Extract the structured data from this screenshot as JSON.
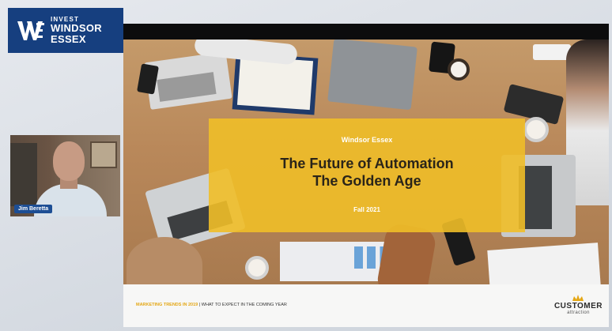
{
  "logo": {
    "line1": "INVEST",
    "line2": "WINDSOR",
    "line3": "ESSEX"
  },
  "presenter": {
    "name": "Jim Beretta"
  },
  "slide": {
    "brand": "Windsor Essex",
    "title_line1": "The Future of Automation",
    "title_line2": "The Golden Age",
    "date": "Fall 2021",
    "footer_highlight": "MARKETING TRENDS IN 2019",
    "footer_rest": "WHAT TO EXPECT IN THE COMING YEAR",
    "footer_logo_main": "CUSTOMER",
    "footer_logo_sub": "attraction"
  },
  "colors": {
    "logo_bg": "#163f7f",
    "overlay": "#f0be28",
    "name_tag": "#1d4e94",
    "footer_accent": "#e4a715"
  }
}
